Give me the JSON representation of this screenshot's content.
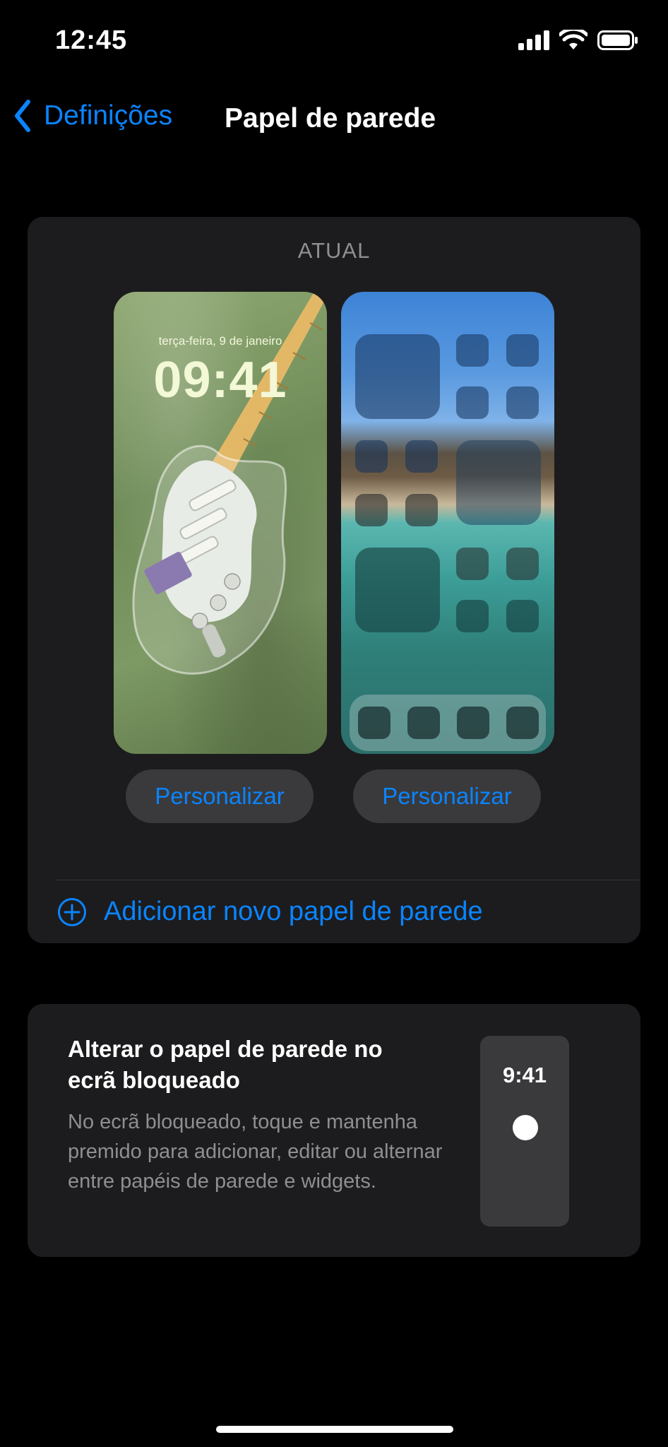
{
  "status_bar": {
    "time": "12:45"
  },
  "nav": {
    "back_label": "Definições",
    "title": "Papel de parede"
  },
  "current_section": {
    "label": "ATUAL",
    "lock_preview": {
      "date": "terça-feira, 9 de janeiro",
      "time": "09:41"
    },
    "lock_customize_label": "Personalizar",
    "home_customize_label": "Personalizar",
    "add_new_label": "Adicionar novo papel de parede"
  },
  "info_card": {
    "title": "Alterar o papel de parede no ecrã bloqueado",
    "description": "No ecrã bloqueado, toque e mantenha premido para adicionar, editar ou alternar entre papéis de parede e widgets.",
    "mini_time": "9:41"
  },
  "colors": {
    "accent": "#0a84ff",
    "card": "#1c1c1e",
    "background": "#000000",
    "secondary_text": "#8e8e93"
  }
}
